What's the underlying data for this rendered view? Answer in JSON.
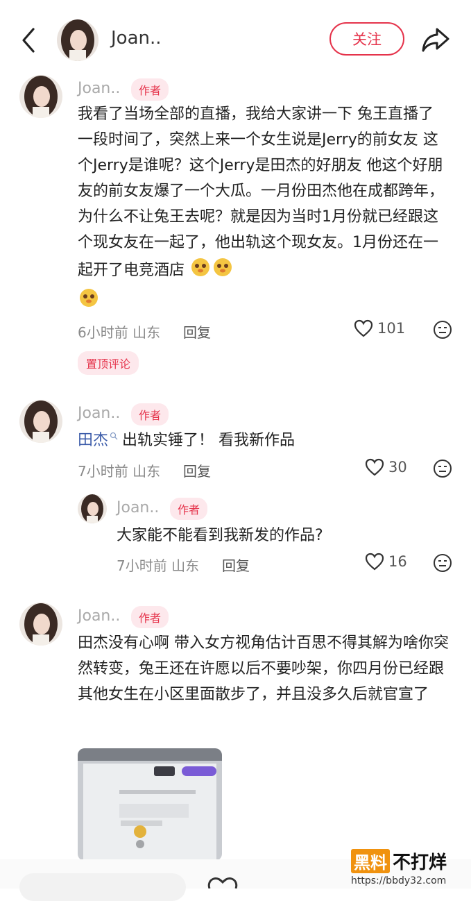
{
  "header": {
    "username": "Joan..",
    "follow_label": "关注"
  },
  "comments": [
    {
      "name": "Joan..",
      "tag": "作者",
      "text": "我看了当场全部的直播，我给大家讲一下 兔王直播了一段时间了，突然上来一个女生说是Jerry的前女友 这个Jerry是谁呢？这个Jerry是田杰的好朋友 他这个好朋友的前女友爆了一个大瓜。一月份田杰他在成都跨年，为什么不让兔王去呢？就是因为当时1月份就已经跟这个现女友在一起了，他出轨这个现女友。1月份还在一起开了电竞酒店",
      "time_loc": "6小时前 山东",
      "reply": "回复",
      "likes": "101",
      "pin": "置顶评论"
    },
    {
      "name": "Joan..",
      "tag": "作者",
      "mention": "田杰",
      "text": "出轨实锤了！ 看我新作品",
      "time_loc": "7小时前 山东",
      "reply": "回复",
      "likes": "30"
    },
    {
      "name": "Joan..",
      "tag": "作者",
      "text": "大家能不能看到我新发的作品?",
      "time_loc": "7小时前 山东",
      "reply": "回复",
      "likes": "16"
    },
    {
      "name": "Joan..",
      "tag": "作者",
      "text": "田杰没有心啊 带入女方视角估计百思不得其解为啥你突然转变，兔王还在许愿以后不要吵架，你四月份已经跟其他女生在小区里面散步了，并且没多久后就官宣了"
    }
  ],
  "watermark": {
    "brand_a": "黑料",
    "brand_b": "不打烊",
    "url": "https://bbdy32.com"
  },
  "colors": {
    "accent": "#e5334b",
    "tag_bg": "#fde8ec",
    "mention": "#3b5ba9"
  }
}
